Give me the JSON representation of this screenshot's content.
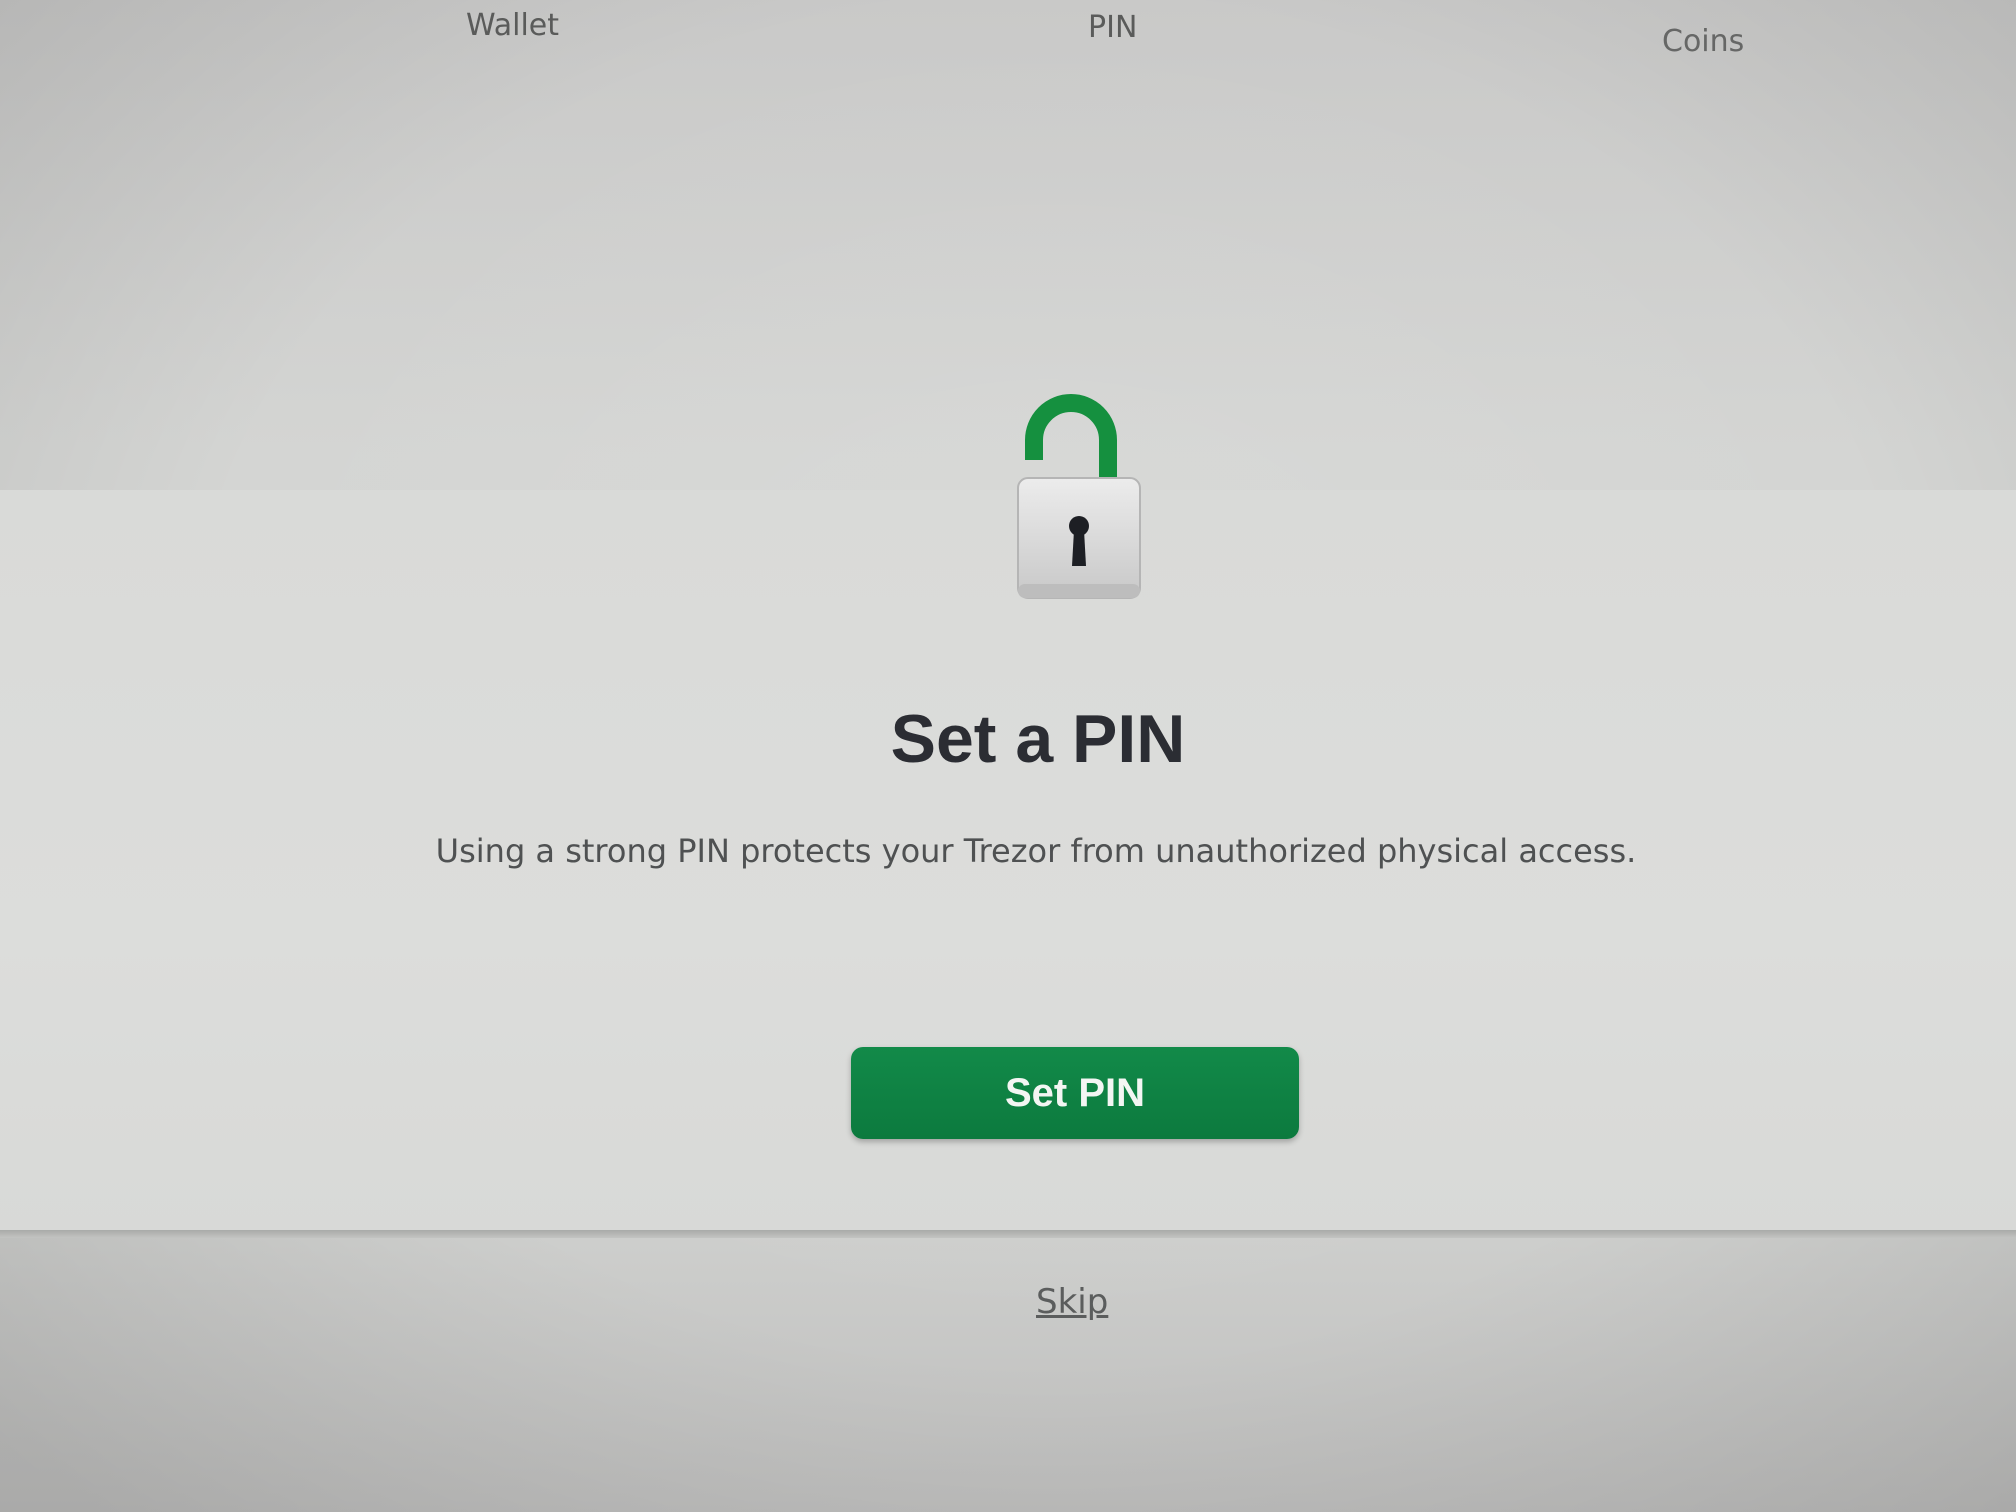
{
  "steps": {
    "wallet": "Wallet",
    "pin": "PIN",
    "coins": "Coins"
  },
  "main": {
    "icon": "open-padlock-icon",
    "title": "Set a PIN",
    "description": "Using a strong PIN protects your Trezor from unauthorized physical access.",
    "primary_button": "Set PIN",
    "skip_link": "Skip"
  },
  "colors": {
    "accent": "#0f8444",
    "title": "#2b2d33",
    "text": "#4f5152",
    "background": "#d6d7d5"
  }
}
